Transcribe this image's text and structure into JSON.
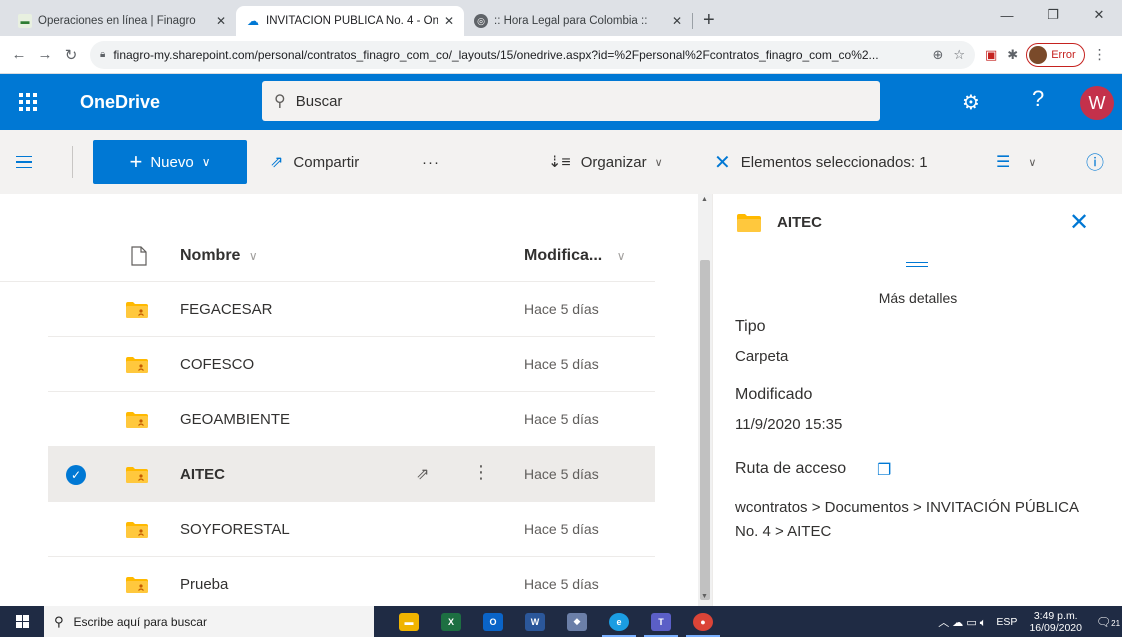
{
  "browser": {
    "tabs": [
      {
        "title": "Operaciones en línea | Finagro",
        "active": false
      },
      {
        "title": "INVITACIÓN PÚBLICA No. 4 - On",
        "active": true
      },
      {
        "title": ":: Hora Legal para Colombia ::",
        "active": false
      }
    ],
    "url": "finagro-my.sharepoint.com/personal/contratos_finagro_com_co/_layouts/15/onedrive.aspx?id=%2Fpersonal%2Fcontratos_finagro_com_co%2...",
    "profile_status": "Error"
  },
  "header": {
    "app_name": "OneDrive",
    "search_placeholder": "Buscar",
    "avatar_initial": "W"
  },
  "commandbar": {
    "new_label": "Nuevo",
    "share_label": "Compartir",
    "more_label": "···",
    "sort_label": "Organizar",
    "selection_label": "Elementos seleccionados: 1"
  },
  "list": {
    "columns": {
      "name": "Nombre",
      "modified": "Modifica..."
    },
    "rows": [
      {
        "name": "FEGACESAR",
        "modified": "Hace 5 días",
        "selected": false
      },
      {
        "name": "COFESCO",
        "modified": "Hace 5 días",
        "selected": false
      },
      {
        "name": "GEOAMBIENTE",
        "modified": "Hace 5 días",
        "selected": false
      },
      {
        "name": "AITEC",
        "modified": "Hace 5 días",
        "selected": true
      },
      {
        "name": "SOYFORESTAL",
        "modified": "Hace 5 días",
        "selected": false
      },
      {
        "name": "Prueba",
        "modified": "Hace 5 días",
        "selected": false
      }
    ]
  },
  "details": {
    "title": "AITEC",
    "more_details": "Más detalles",
    "type_label": "Tipo",
    "type_value": "Carpeta",
    "modified_label": "Modificado",
    "modified_value": "11/9/2020 15:35",
    "path_label": "Ruta de acceso",
    "path_value": "wcontratos > Documentos > INVITACIÓN PÚBLICA No. 4 > AITEC"
  },
  "taskbar": {
    "search_placeholder": "Escribe aquí para buscar",
    "language": "ESP",
    "time": "3:49 p.m.",
    "date": "16/09/2020",
    "notifications": "21"
  },
  "colors": {
    "brand": "#0078d4",
    "folder": "#ffb900",
    "avatar": "#c4314b"
  }
}
